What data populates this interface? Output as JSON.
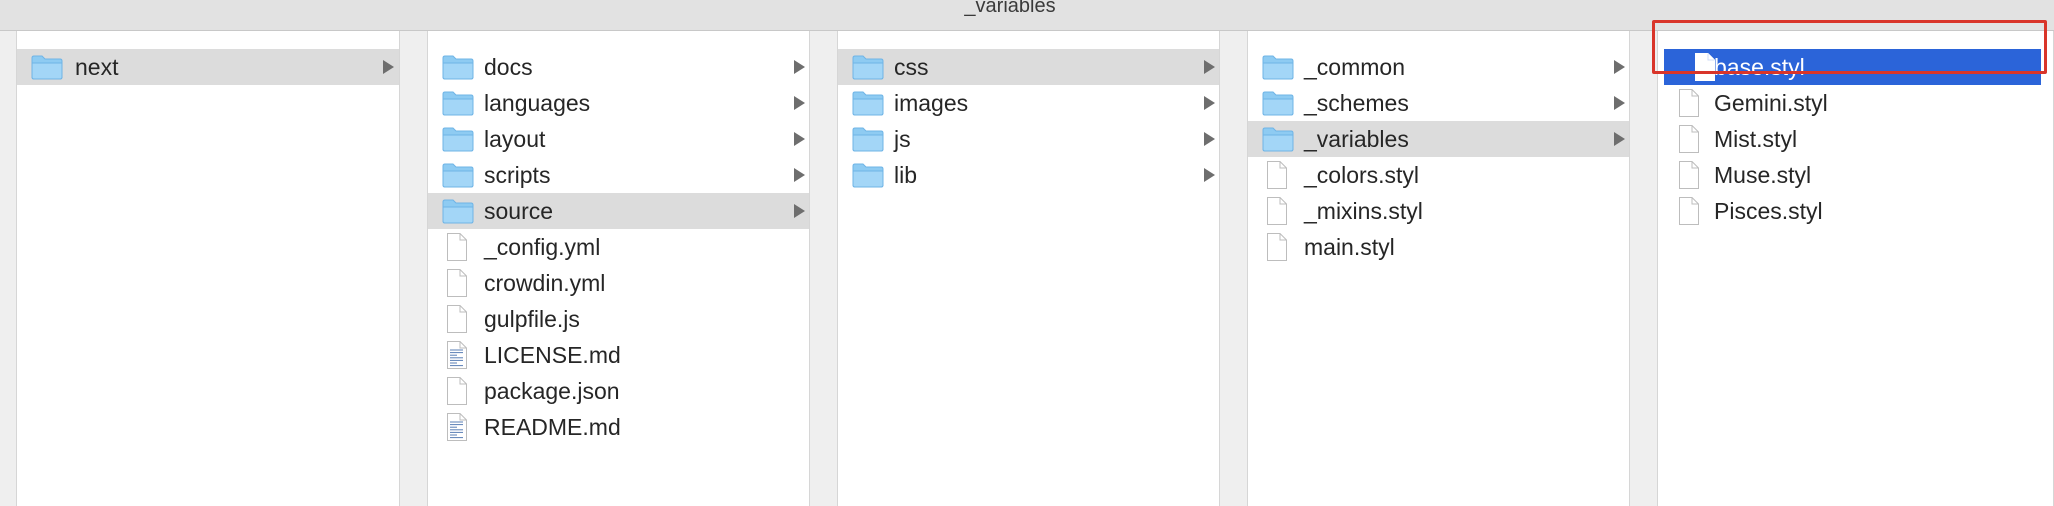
{
  "window": {
    "title": "_variables"
  },
  "columns": [
    {
      "items": [
        {
          "label": "next",
          "type": "folder",
          "arrow": true,
          "selected": "gray"
        }
      ]
    },
    {
      "items": [
        {
          "label": "docs",
          "type": "folder",
          "arrow": true
        },
        {
          "label": "languages",
          "type": "folder",
          "arrow": true
        },
        {
          "label": "layout",
          "type": "folder",
          "arrow": true
        },
        {
          "label": "scripts",
          "type": "folder",
          "arrow": true
        },
        {
          "label": "source",
          "type": "folder",
          "arrow": true,
          "selected": "gray"
        },
        {
          "label": "_config.yml",
          "type": "file"
        },
        {
          "label": "crowdin.yml",
          "type": "file"
        },
        {
          "label": "gulpfile.js",
          "type": "file"
        },
        {
          "label": "LICENSE.md",
          "type": "textfile"
        },
        {
          "label": "package.json",
          "type": "file"
        },
        {
          "label": "README.md",
          "type": "textfile"
        }
      ]
    },
    {
      "items": [
        {
          "label": "css",
          "type": "folder",
          "arrow": true,
          "selected": "gray"
        },
        {
          "label": "images",
          "type": "folder",
          "arrow": true
        },
        {
          "label": "js",
          "type": "folder",
          "arrow": true
        },
        {
          "label": "lib",
          "type": "folder",
          "arrow": true
        }
      ]
    },
    {
      "items": [
        {
          "label": "_common",
          "type": "folder",
          "arrow": true
        },
        {
          "label": "_schemes",
          "type": "folder",
          "arrow": true
        },
        {
          "label": "_variables",
          "type": "folder",
          "arrow": true,
          "selected": "gray"
        },
        {
          "label": "_colors.styl",
          "type": "file"
        },
        {
          "label": "_mixins.styl",
          "type": "file"
        },
        {
          "label": "main.styl",
          "type": "file"
        }
      ]
    },
    {
      "items": [
        {
          "label": "base.styl",
          "type": "file",
          "selected": "blue"
        },
        {
          "label": "Gemini.styl",
          "type": "file"
        },
        {
          "label": "Mist.styl",
          "type": "file"
        },
        {
          "label": "Muse.styl",
          "type": "file"
        },
        {
          "label": "Pisces.styl",
          "type": "file"
        }
      ]
    }
  ],
  "colors": {
    "folder": "#8ecbf2",
    "selection_blue": "#2b64d9",
    "selection_gray": "#dcdcdc",
    "highlight": "#d9352a"
  },
  "icons": {
    "folder": "folder-icon",
    "file": "document-icon",
    "textfile": "text-document-icon",
    "arrow": "disclosure-arrow-icon"
  }
}
